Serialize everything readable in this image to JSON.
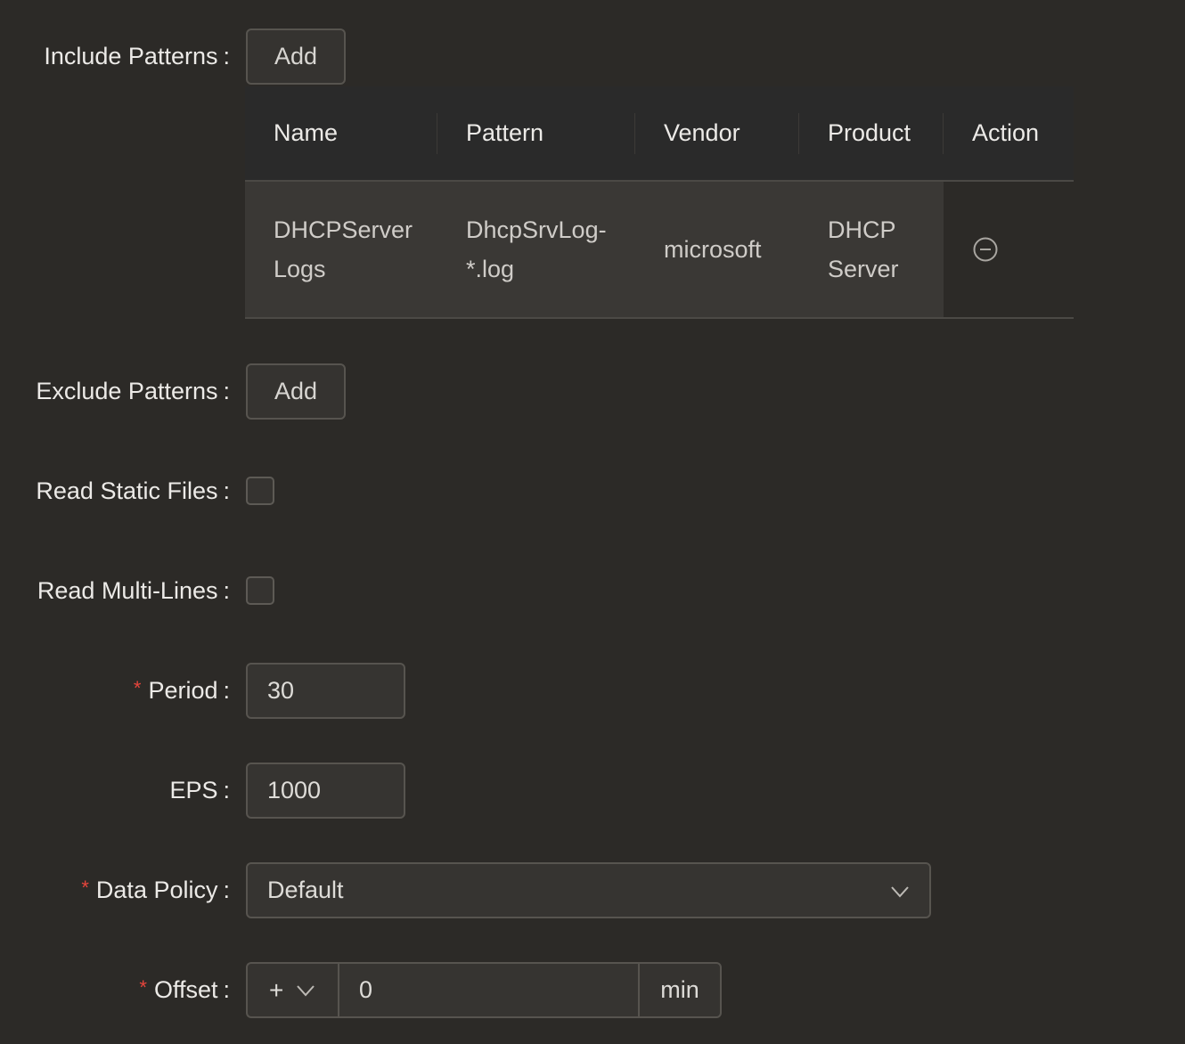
{
  "include_patterns": {
    "label": "Include Patterns",
    "add_label": "Add",
    "columns": [
      "Name",
      "Pattern",
      "Vendor",
      "Product",
      "Action"
    ],
    "rows": [
      {
        "name_line1": "DHCPServer",
        "name_line2": "Logs",
        "pattern_line1": "DhcpSrvLog-",
        "pattern_line2": "*.log",
        "vendor": "microsoft",
        "product_line1": "DHCP",
        "product_line2": "Server",
        "action_icon": "minus-circle-icon"
      }
    ]
  },
  "exclude_patterns": {
    "label": "Exclude Patterns",
    "add_label": "Add"
  },
  "read_static_files": {
    "label": "Read Static Files",
    "checked": false
  },
  "read_multi_lines": {
    "label": "Read Multi-Lines",
    "checked": false
  },
  "period": {
    "label": "Period",
    "required": true,
    "value": "30"
  },
  "eps": {
    "label": "EPS",
    "value": "1000"
  },
  "data_policy": {
    "label": "Data Policy",
    "required": true,
    "value": "Default"
  },
  "offset": {
    "label": "Offset",
    "required": true,
    "sign": "+",
    "value": "0",
    "unit": "min"
  },
  "colon": ":",
  "required_mark": "*",
  "colors": {
    "background": "#2c2a27",
    "required": "#e8453c",
    "border": "#57544f"
  }
}
